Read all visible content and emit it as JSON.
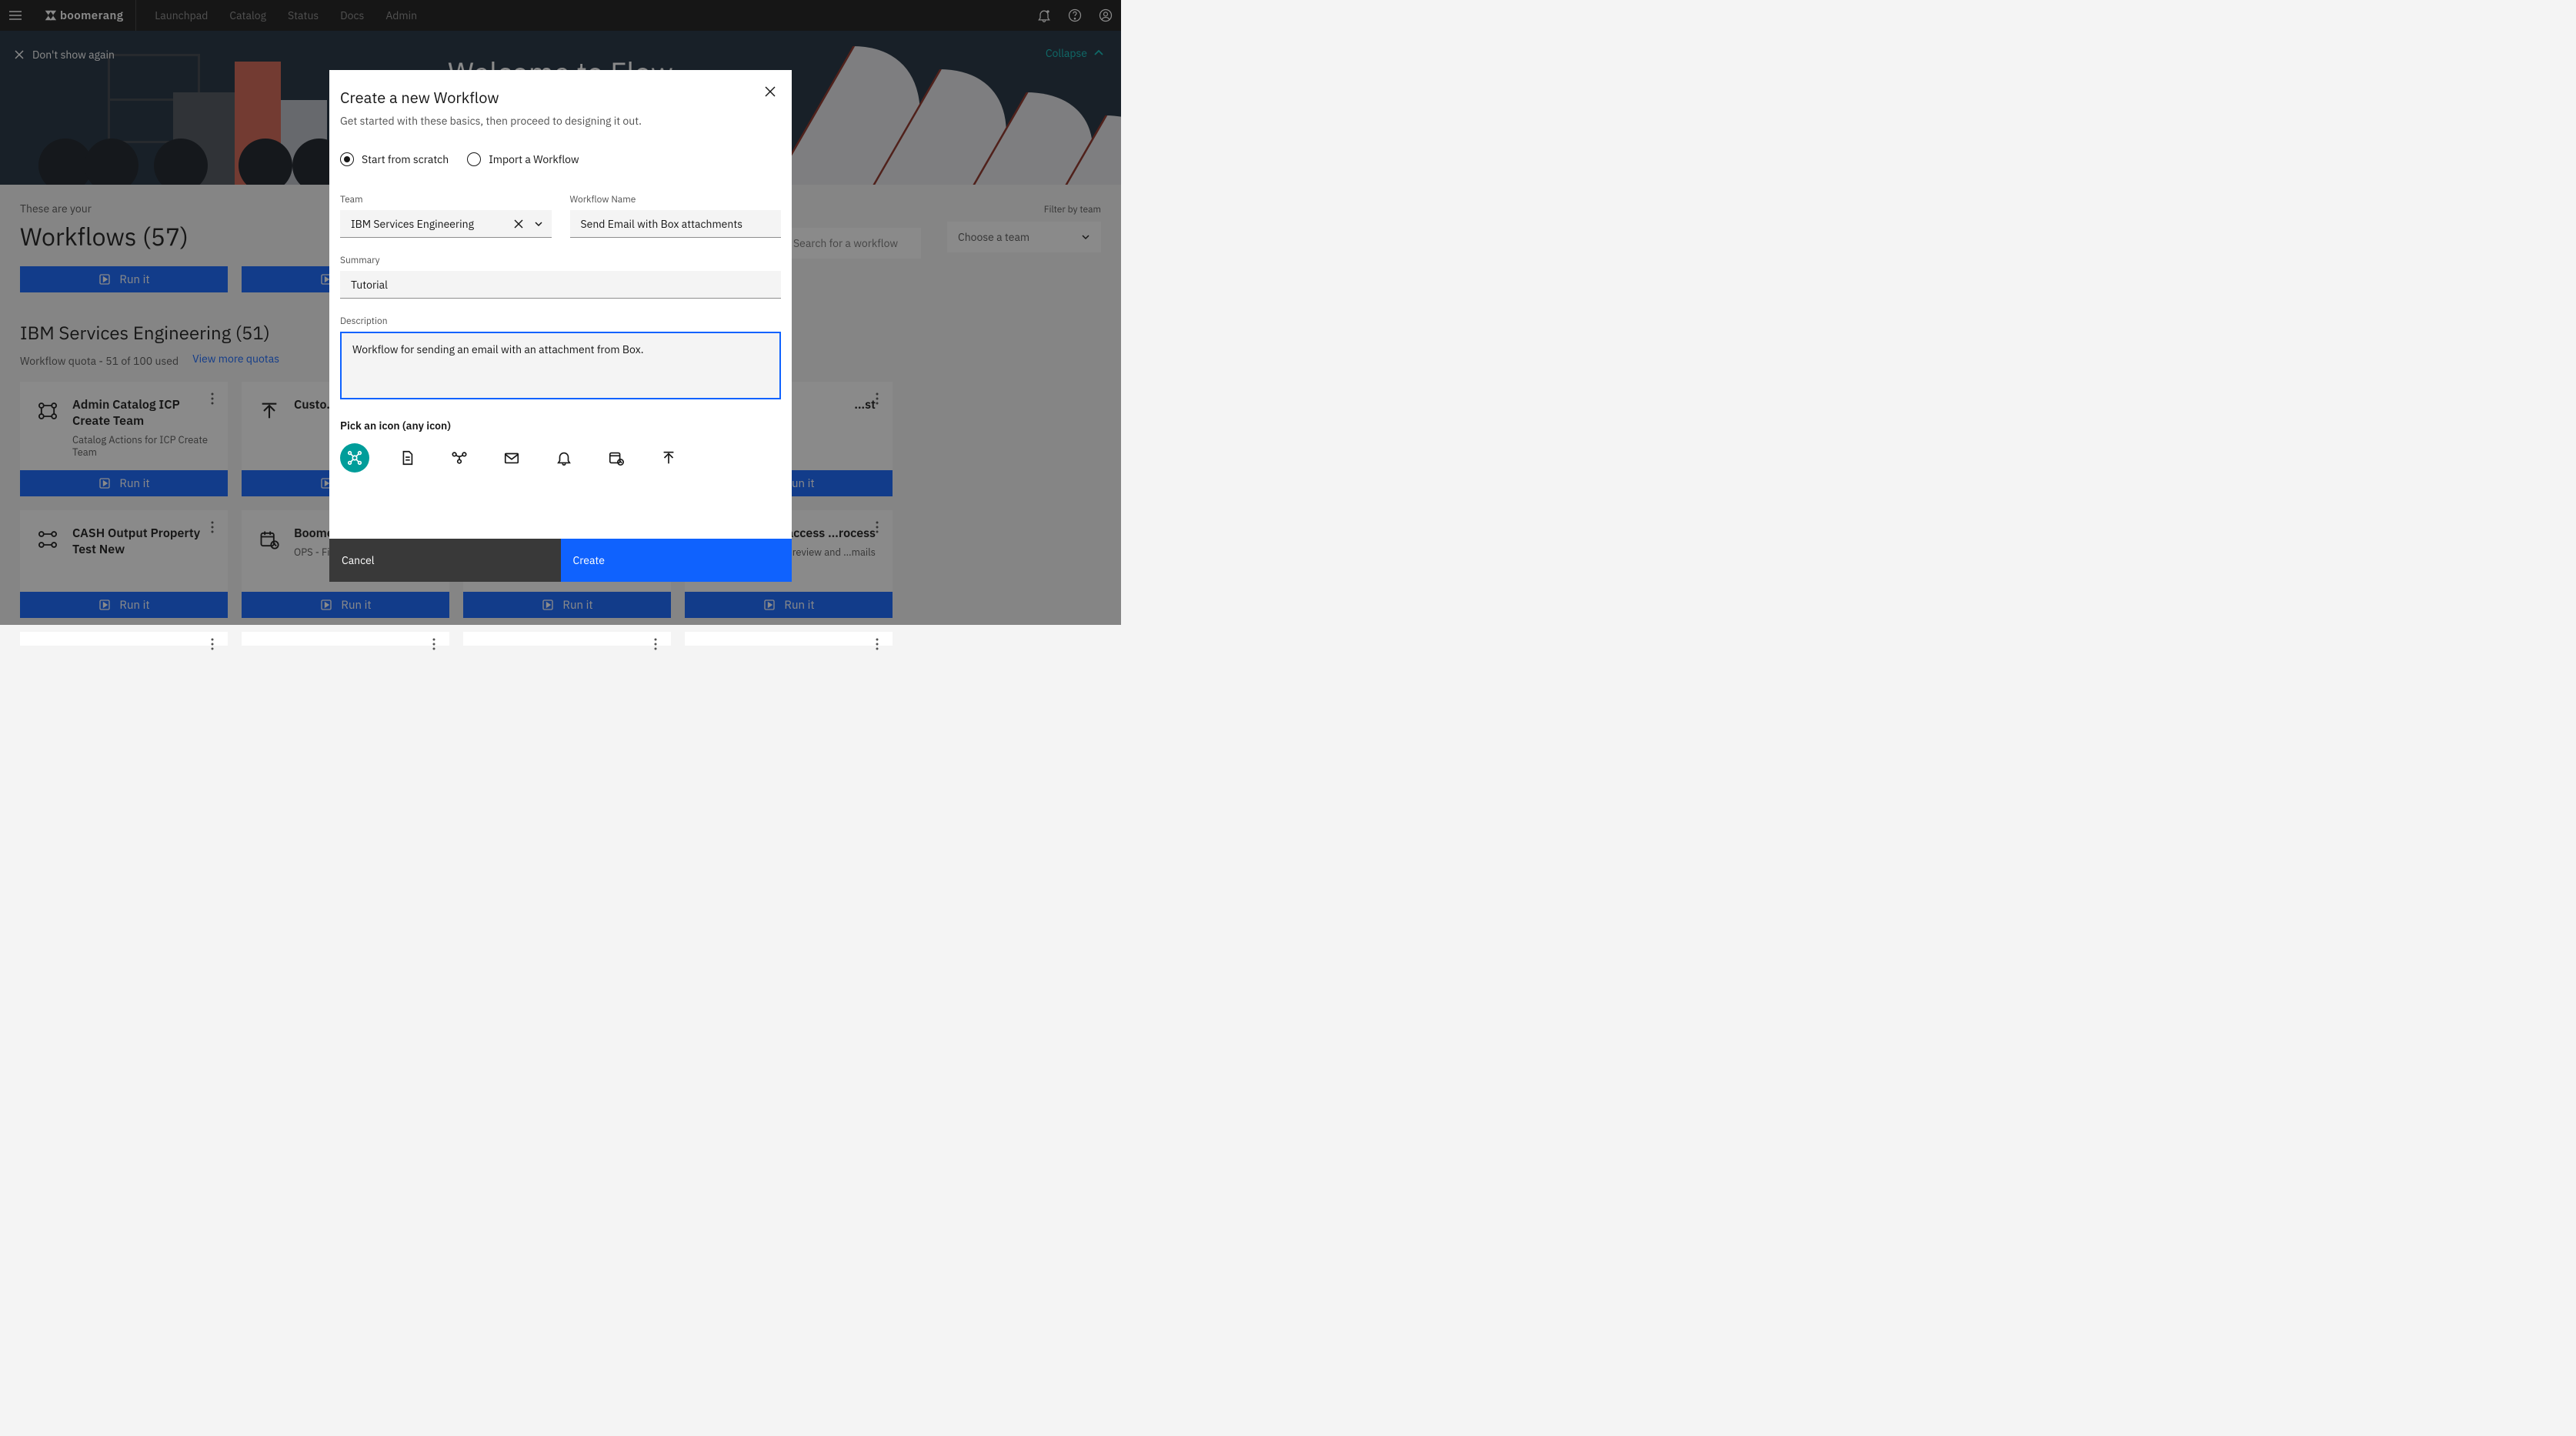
{
  "header": {
    "brand": "boomerang",
    "nav": [
      "Launchpad",
      "Catalog",
      "Status",
      "Docs",
      "Admin"
    ]
  },
  "hero": {
    "title": "Welcome to Flow",
    "dont_show": "Don't show again",
    "collapse": "Collapse"
  },
  "page": {
    "intro_small": "These are your",
    "intro_big": "Workflows (57)",
    "filter_label": "Filter by team",
    "filter_value": "Choose a team",
    "search_placeholder": "Search for a workflow"
  },
  "top_run_label": "Run it",
  "section": {
    "title": "IBM Services Engineering (51)",
    "quota": "Workflow quota - 51 of 100 used",
    "quota_link": "View more quotas"
  },
  "run_label": "Run it",
  "cards_row1": [
    {
      "title": "Admin Catalog ICP Create Team",
      "desc": "Catalog Actions for ICP Create Team",
      "icon": "flow"
    },
    {
      "title": "Custo…",
      "desc": "",
      "icon": "upload"
    },
    {
      "title": "",
      "desc": "",
      "icon": ""
    },
    {
      "title": "…st",
      "desc": "",
      "icon": ""
    }
  ],
  "cards_row2": [
    {
      "title": "CASH Output Property Test New",
      "desc": "",
      "icon": "flow"
    },
    {
      "title": "Boome… GitHu…",
      "desc": "OPS - Fin… Issues",
      "icon": "schedule"
    },
    {
      "title": "",
      "desc": "",
      "icon": ""
    },
    {
      "title": "…xternal access …rocess",
      "desc": "…ernal review and …mails",
      "icon": ""
    }
  ],
  "modal": {
    "title": "Create a new Workflow",
    "subtitle": "Get started with these basics, then proceed to designing it out.",
    "radio_scratch": "Start from scratch",
    "radio_import": "Import a Workflow",
    "team_label": "Team",
    "team_value": "IBM Services Engineering",
    "name_label": "Workflow Name",
    "name_value": "Send Email with Box attachments",
    "summary_label": "Summary",
    "summary_value": "Tutorial",
    "desc_label": "Description",
    "desc_value": "Workflow for sending an email with an attachment from Box.",
    "icon_label": "Pick an icon (any icon)",
    "cancel": "Cancel",
    "create": "Create"
  }
}
